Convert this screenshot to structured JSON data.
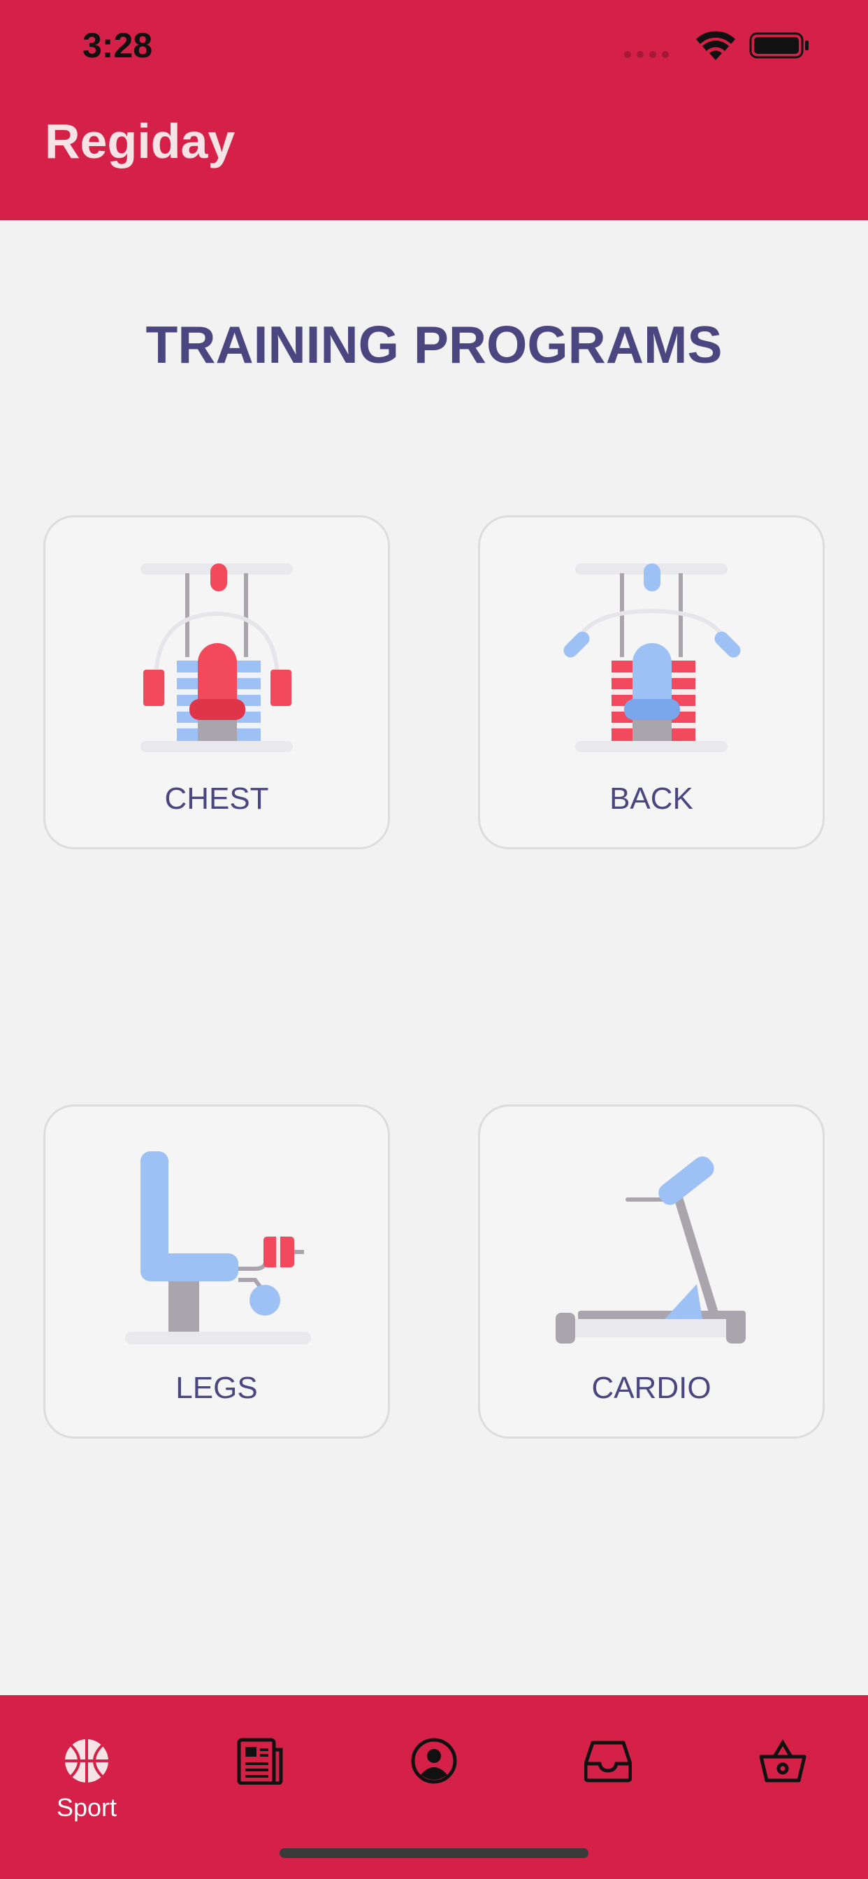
{
  "status_bar": {
    "time": "3:28",
    "icons": [
      "signal-dots-icon",
      "wifi-icon",
      "battery-icon"
    ]
  },
  "header": {
    "title": "Regiday"
  },
  "main": {
    "title": "TRAINING PROGRAMS",
    "cards": [
      {
        "label": "CHEST",
        "icon": "chest-machine-icon"
      },
      {
        "label": "BACK",
        "icon": "back-machine-icon"
      },
      {
        "label": "LEGS",
        "icon": "leg-machine-icon"
      },
      {
        "label": "CARDIO",
        "icon": "treadmill-icon"
      }
    ]
  },
  "bottom_nav": {
    "items": [
      {
        "label": "Sport",
        "icon": "basketball-icon",
        "active": true
      },
      {
        "label": "",
        "icon": "newspaper-icon"
      },
      {
        "label": "",
        "icon": "profile-icon"
      },
      {
        "label": "",
        "icon": "inbox-icon"
      },
      {
        "label": "",
        "icon": "basket-icon"
      }
    ]
  },
  "colors": {
    "primary": "#d52147",
    "title": "#4b4680",
    "background": "#f2f2f2",
    "red_accent": "#f2495c",
    "blue_accent": "#9ec1f5"
  }
}
